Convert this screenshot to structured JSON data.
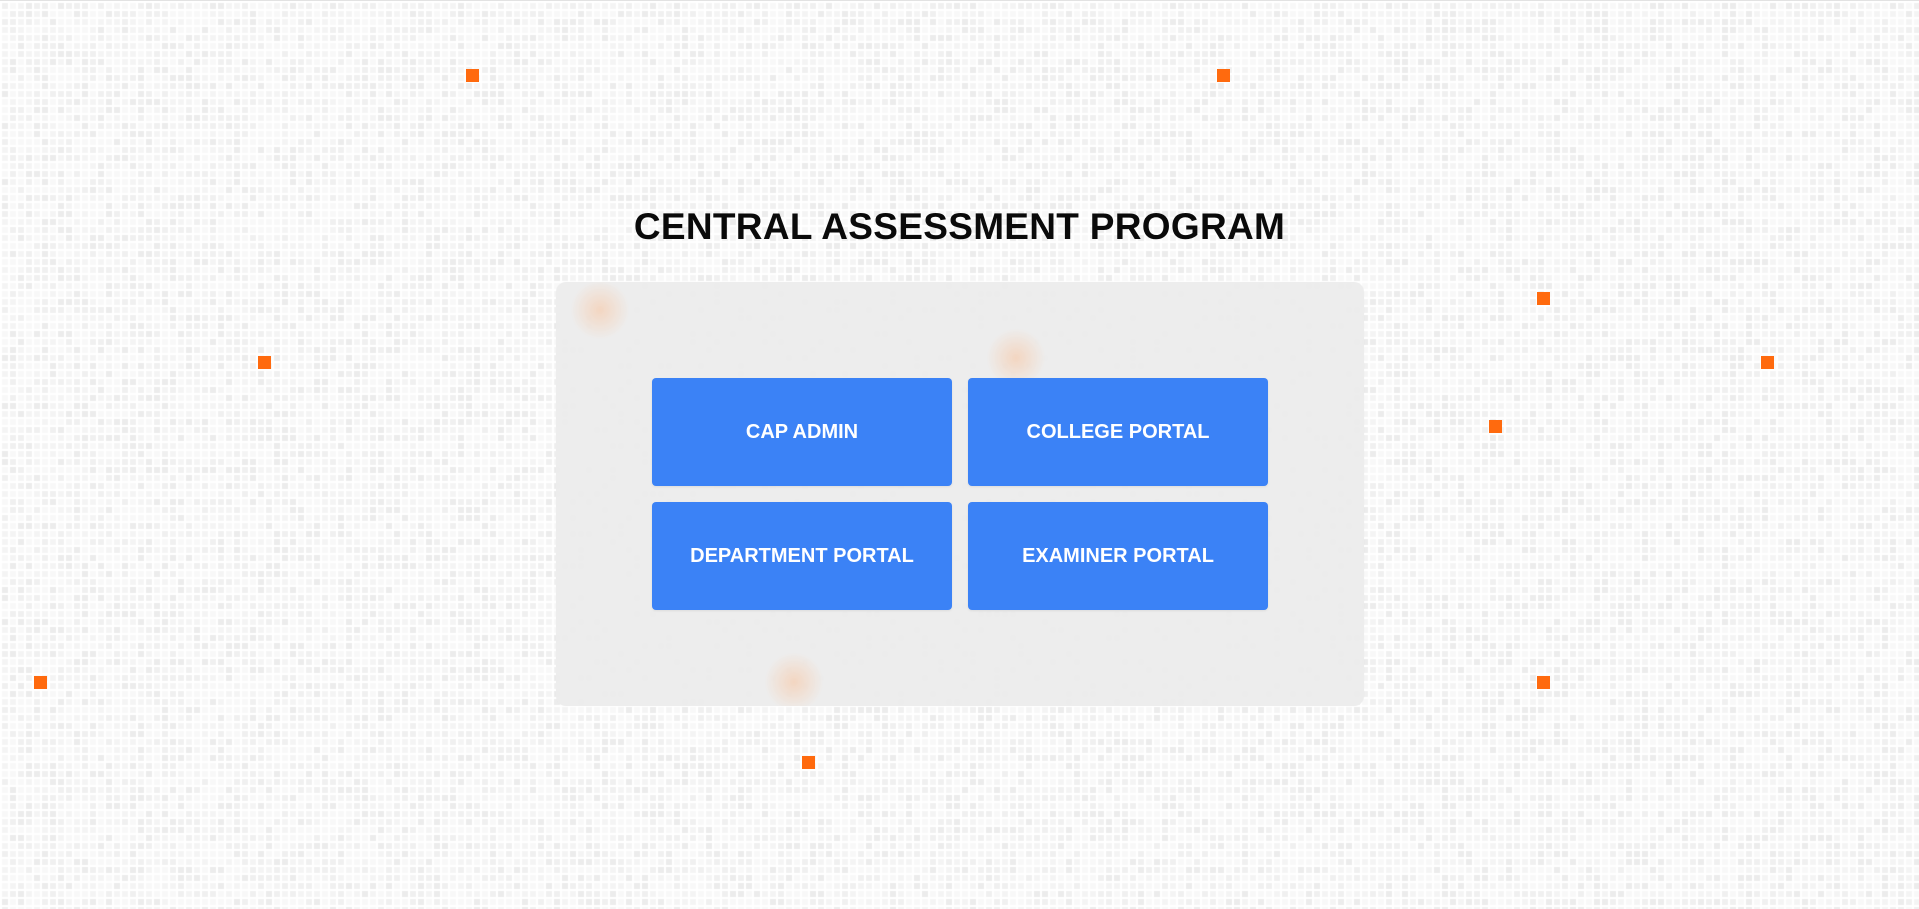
{
  "page": {
    "title": "CENTRAL ASSESSMENT PROGRAM"
  },
  "portals": [
    {
      "label": "CAP ADMIN"
    },
    {
      "label": "COLLEGE PORTAL"
    },
    {
      "label": "DEPARTMENT PORTAL"
    },
    {
      "label": "EXAMINER PORTAL"
    }
  ],
  "colors": {
    "button": "#3b82f6",
    "button_text": "#ffffff",
    "accent_squares": "#ff6a0e",
    "panel": "#ececec",
    "title": "#0a0a0a"
  }
}
